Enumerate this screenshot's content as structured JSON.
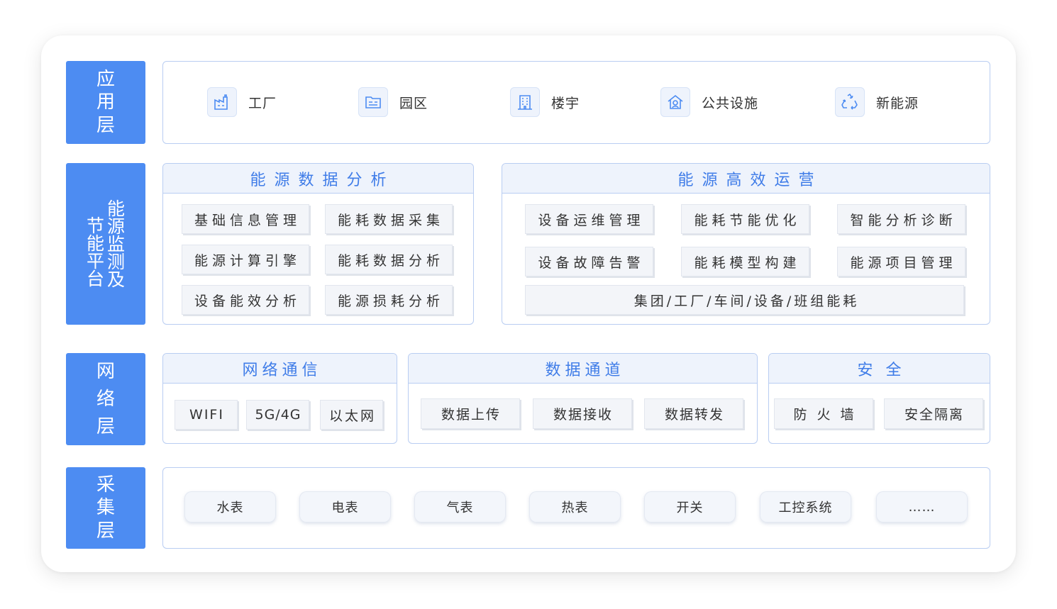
{
  "layers": {
    "application": "应用层",
    "platform_col1": "能源监测及",
    "platform_col2": "节能平台",
    "network": "网络层",
    "collection": "采集层"
  },
  "application_items": [
    {
      "label": "工厂",
      "icon": "factory-icon"
    },
    {
      "label": "园区",
      "icon": "park-icon"
    },
    {
      "label": "楼宇",
      "icon": "building-icon"
    },
    {
      "label": "公共设施",
      "icon": "public-facility-icon"
    },
    {
      "label": "新能源",
      "icon": "recycle-icon"
    }
  ],
  "energy_analysis": {
    "title": "能源数据分析",
    "items": [
      "基础信息管理",
      "能耗数据采集",
      "能源计算引擎",
      "能耗数据分析",
      "设备能效分析",
      "能源损耗分析"
    ]
  },
  "energy_operation": {
    "title": "能源高效运营",
    "items": [
      "设备运维管理",
      "能耗节能优化",
      "智能分析诊断",
      "设备故障告警",
      "能耗模型构建",
      "能源项目管理"
    ],
    "wide_item": "集团/工厂/车间/设备/班组能耗"
  },
  "network_comm": {
    "title": "网络通信",
    "items": [
      "WIFI",
      "5G/4G",
      "以太网"
    ]
  },
  "data_channel": {
    "title": "数据通道",
    "items": [
      "数据上传",
      "数据接收",
      "数据转发"
    ]
  },
  "security": {
    "title": "安全",
    "items": [
      "防火墙",
      "安全隔离"
    ]
  },
  "collection_items": [
    "水表",
    "电表",
    "气表",
    "热表",
    "开关",
    "工控系统",
    "……"
  ],
  "colors": {
    "primary": "#4d8cf2",
    "header_text": "#3f7ce8",
    "border": "#b9cdf2",
    "header_bg": "#eef3fc",
    "chip_bg": "#f3f5f9"
  }
}
